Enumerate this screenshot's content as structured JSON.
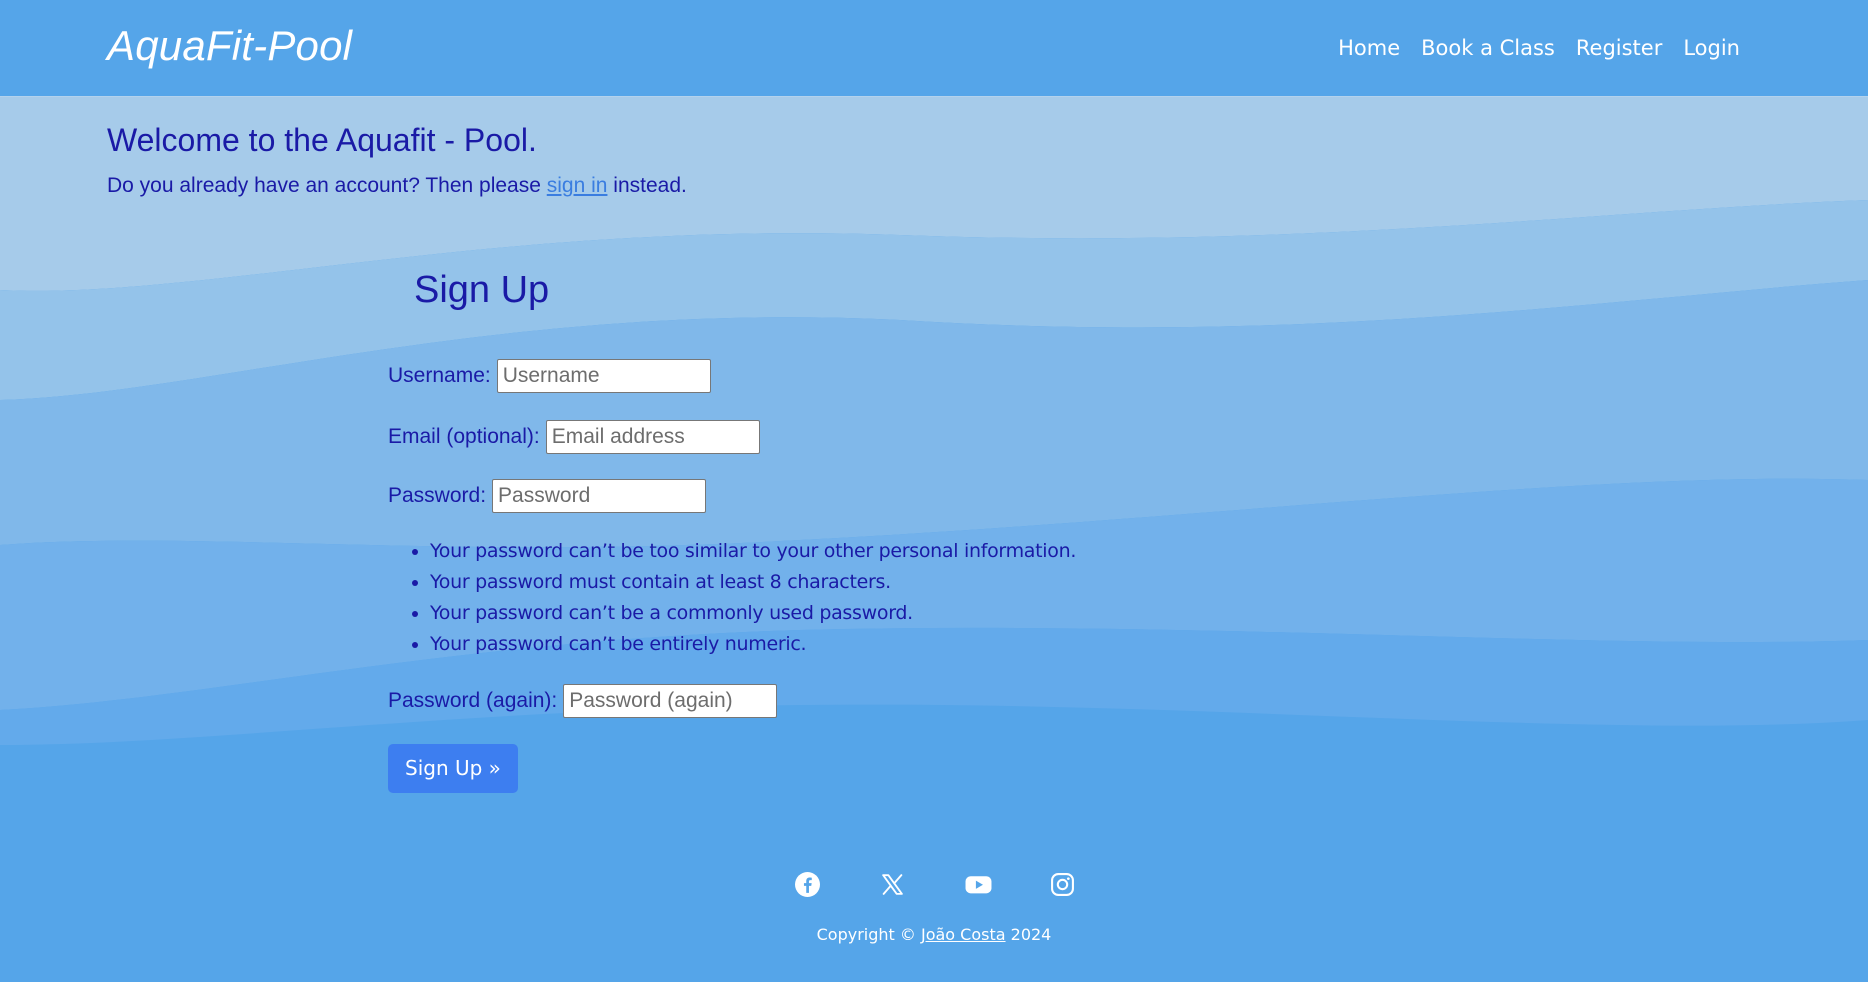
{
  "navbar": {
    "brand": "AquaFit-Pool",
    "links": [
      "Home",
      "Book a Class",
      "Register",
      "Login"
    ]
  },
  "main": {
    "welcome": "Welcome to the Aquafit - Pool.",
    "intro_before": "Do you already have an account? Then please ",
    "intro_link": "sign in",
    "intro_after": " instead.",
    "form_title": "Sign Up",
    "fields": {
      "username": {
        "label": "Username:",
        "placeholder": "Username",
        "value": ""
      },
      "email": {
        "label": "Email (optional):",
        "placeholder": "Email address",
        "value": ""
      },
      "password": {
        "label": "Password:",
        "placeholder": "Password",
        "value": ""
      },
      "password2": {
        "label": "Password (again):",
        "placeholder": "Password (again)",
        "value": ""
      }
    },
    "password_help": [
      "Your password can’t be too similar to your other personal information.",
      "Your password must contain at least 8 characters.",
      "Your password can’t be a commonly used password.",
      "Your password can’t be entirely numeric."
    ],
    "submit": "Sign Up »"
  },
  "footer": {
    "social_icons": [
      "facebook-icon",
      "x-icon",
      "youtube-icon",
      "instagram-icon"
    ],
    "copyright_prefix": "Copyright © ",
    "author": "João Costa",
    "copyright_suffix": " 2024"
  },
  "colors": {
    "navbar_bg": "#55a5e9",
    "text": "#1a1aa6",
    "link": "#3a7de0",
    "button": "#3d7ef0"
  }
}
